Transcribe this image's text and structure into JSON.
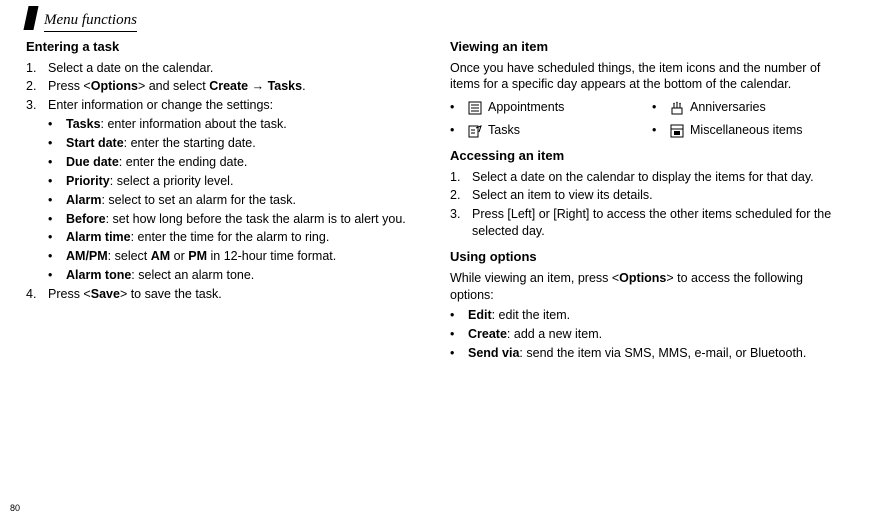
{
  "page_number": "80",
  "header": "Menu functions",
  "left": {
    "title": "Entering a task",
    "steps": [
      {
        "num": "1.",
        "text": "Select a date on the calendar."
      },
      {
        "num": "2.",
        "lt": "Press <",
        "strong1": "Options",
        "mid": "> and select ",
        "strong2": "Create",
        "arrow": " → ",
        "strong3": "Tasks",
        "end": "."
      },
      {
        "num": "3.",
        "text": "Enter information or change the settings:"
      }
    ],
    "bullets": [
      {
        "k": "Tasks",
        "v": ": enter information about the task."
      },
      {
        "k": "Start date",
        "v": ": enter the starting date."
      },
      {
        "k": "Due date",
        "v": ": enter the ending date."
      },
      {
        "k": "Priority",
        "v": ": select a priority level."
      },
      {
        "k": "Alarm",
        "v": ": select to set an alarm for the task."
      },
      {
        "k": "Before",
        "v": ": set how long before the task the alarm is to alert you."
      },
      {
        "k": "Alarm time",
        "v": ": enter the time for the alarm to ring."
      },
      {
        "k": "AM/PM",
        "pre": ": select ",
        "s1": "AM",
        "mid": " or ",
        "s2": "PM",
        "post": " in 12-hour time format."
      },
      {
        "k": "Alarm tone",
        "v": ": select an alarm tone."
      }
    ],
    "step4": {
      "num": "4.",
      "pre": "Press <",
      "s": "Save",
      "post": "> to save the task."
    }
  },
  "right": {
    "title1": "Viewing an item",
    "para1": "Once you have scheduled things, the item icons and the number of items for a specific day appears at the bottom of the calendar.",
    "icons": [
      {
        "name": "appointments-icon",
        "label": "Appointments"
      },
      {
        "name": "anniversaries-icon",
        "label": "Anniversaries"
      },
      {
        "name": "tasks-icon",
        "label": "Tasks"
      },
      {
        "name": "misc-icon",
        "label": "Miscellaneous items"
      }
    ],
    "title2": "Accessing an item",
    "steps2": [
      {
        "num": "1.",
        "text": "Select a date on the calendar to display the items for that day."
      },
      {
        "num": "2.",
        "text": "Select an item to view its details."
      },
      {
        "num": "3.",
        "text": "Press [Left] or [Right] to access the other items scheduled for the selected day."
      }
    ],
    "title3": "Using options",
    "para3_pre": "While viewing an item, press <",
    "para3_strong": "Options",
    "para3_post": "> to access the following options:",
    "bullets3": [
      {
        "k": "Edit",
        "v": ": edit the item."
      },
      {
        "k": "Create",
        "v": ": add a new item."
      },
      {
        "k": "Send via",
        "v": ": send the item via SMS, MMS, e-mail, or Bluetooth."
      }
    ]
  }
}
